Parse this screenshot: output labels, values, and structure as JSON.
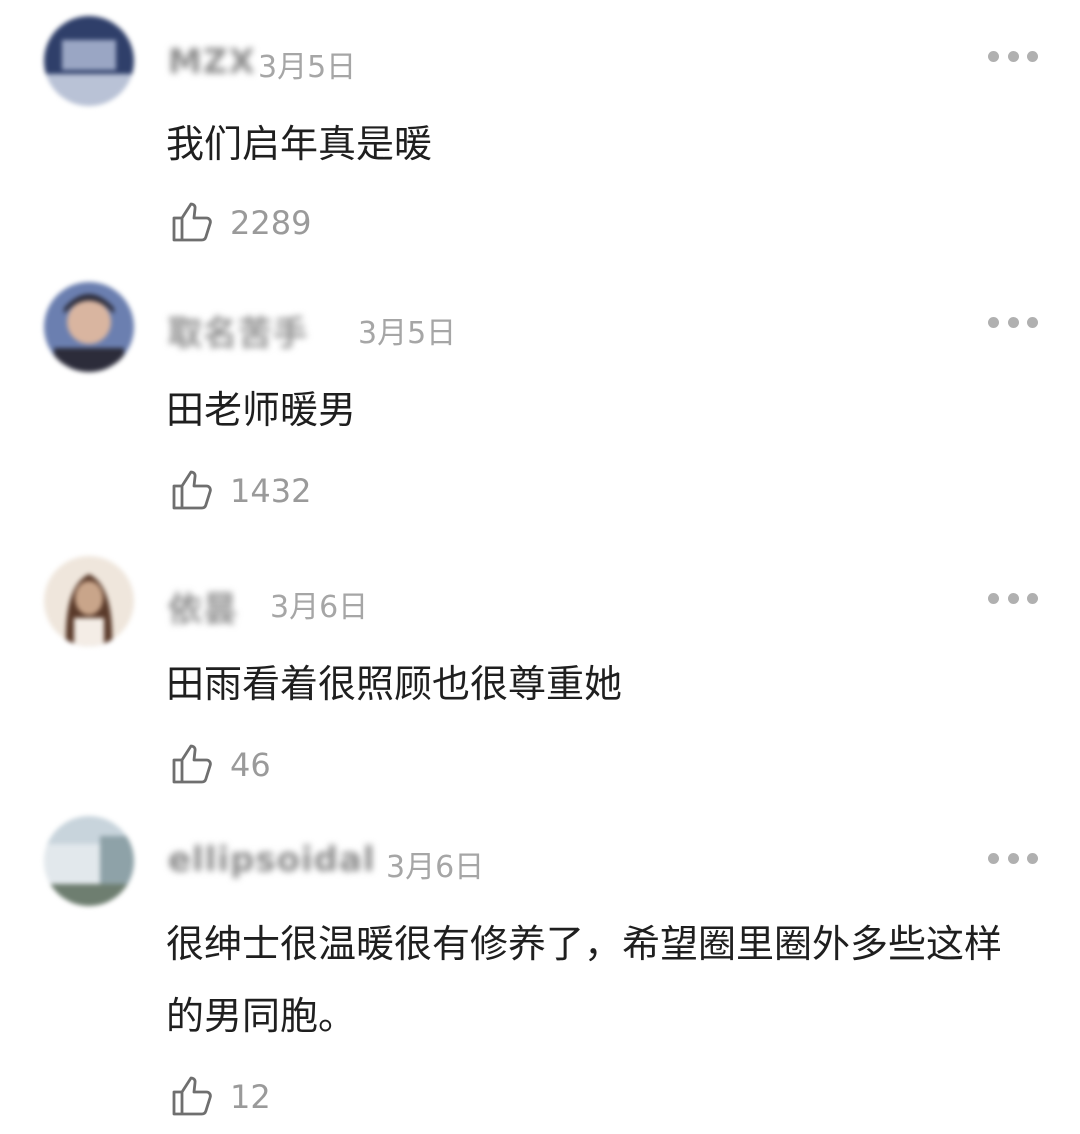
{
  "comments": [
    {
      "username": "MZX",
      "date": "3月5日",
      "text": "我们启年真是暖",
      "likes": "2289",
      "avatar_colors": [
        "#2f3f6a",
        "#9aa6c4",
        "#e8ecf4"
      ]
    },
    {
      "username": "取名苦手",
      "date": "3月5日",
      "text": "田老师暖男",
      "likes": "1432",
      "avatar_colors": [
        "#2c2c3a",
        "#d9b5a0",
        "#6b7fb0"
      ]
    },
    {
      "username": "依昙",
      "date": "3月6日",
      "text": "田雨看着很照顾也很尊重她",
      "likes": "46",
      "avatar_colors": [
        "#c9a58a",
        "#5a3a2a",
        "#efe6dc"
      ]
    },
    {
      "username": "ellipsoidal",
      "date": "3月6日",
      "text": "很绅士很温暖很有修养了，希望圈里圈外多些这样的男同胞。",
      "likes": "12",
      "avatar_colors": [
        "#c8d4dc",
        "#8ea2a8",
        "#6e7e70"
      ]
    }
  ],
  "icons": {
    "like": "thumbs-up-icon",
    "more": "more-dots-icon"
  }
}
